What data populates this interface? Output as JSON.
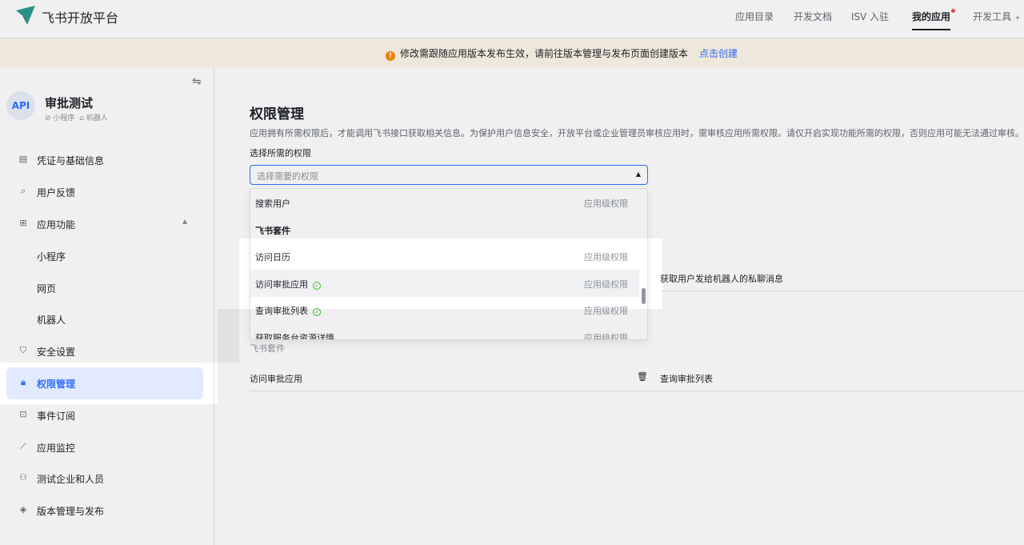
{
  "header": {
    "brand": "飞书开放平台",
    "nav": [
      {
        "label": "应用目录"
      },
      {
        "label": "开发文档"
      },
      {
        "label": "ISV 入驻"
      },
      {
        "label": "我的应用"
      },
      {
        "label": "开发工具"
      }
    ]
  },
  "notice": {
    "text": "修改需跟随应用版本发布生效，请前往版本管理与发布页面创建版本",
    "link": "点击创建"
  },
  "sidebar": {
    "avatar": "API",
    "app_name": "审批测试",
    "tag_mini": "小程序",
    "tag_bot": "机器人",
    "items": [
      {
        "label": "凭证与基础信息",
        "icon": "credential-icon"
      },
      {
        "label": "用户反馈",
        "icon": "feedback-icon"
      },
      {
        "label": "应用功能",
        "icon": "apps-icon"
      },
      {
        "label": "小程序"
      },
      {
        "label": "网页"
      },
      {
        "label": "机器人"
      },
      {
        "label": "安全设置",
        "icon": "shield-icon"
      },
      {
        "label": "权限管理",
        "icon": "lock-icon"
      },
      {
        "label": "事件订阅",
        "icon": "event-icon"
      },
      {
        "label": "应用监控",
        "icon": "chart-icon"
      },
      {
        "label": "测试企业和人员",
        "icon": "people-icon"
      },
      {
        "label": "版本管理与发布",
        "icon": "layers-icon"
      }
    ]
  },
  "main": {
    "title": "权限管理",
    "description": "应用拥有所需权限后，才能调用飞书接口获取相关信息。为保护用户信息安全，开放平台或企业管理员审核应用时，需审核应用所需权限。请仅开启实现功能所需的权限，否则应用可能无法通过审核。",
    "select_label": "选择所需的权限",
    "select_placeholder": "选择需要的权限",
    "behind_right_text": "获取用户发给机器人的私聊消息",
    "behind_group": "飞书套件",
    "behind_row_left": "访问审批应用",
    "behind_row_right": "查询审批列表"
  },
  "dropdown": {
    "items": [
      {
        "label": "搜索用户",
        "tag": "应用级权限"
      },
      {
        "group": "飞书套件"
      },
      {
        "label": "访问日历",
        "tag": "应用级权限"
      },
      {
        "label": "访问审批应用",
        "tag": "应用级权限",
        "checked": true
      },
      {
        "label": "查询审批列表",
        "tag": "应用级权限",
        "checked": true
      },
      {
        "label": "获取服务台资源详情",
        "tag": "应用级权限"
      }
    ]
  }
}
